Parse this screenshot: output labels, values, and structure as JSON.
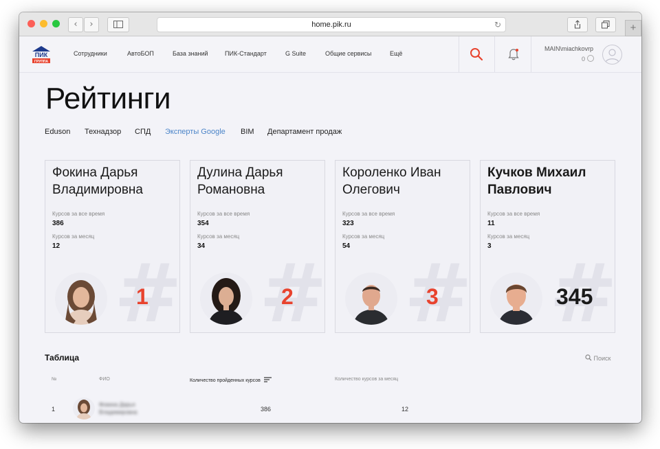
{
  "browser": {
    "url": "home.pik.ru"
  },
  "header": {
    "logo_text_top": "ПИК",
    "logo_text_bottom": "ГРУППА",
    "nav": [
      "Сотрудники",
      "АвтоБОП",
      "База знаний",
      "ПИК-Стандарт",
      "G Suite",
      "Общие сервисы",
      "Ещё"
    ],
    "user": "MAIN\\miachkovrp",
    "counter": "0",
    "accent": "#e8432e"
  },
  "page": {
    "title": "Рейтинги"
  },
  "tabs": [
    {
      "label": "Eduson",
      "active": false
    },
    {
      "label": "Технадзор",
      "active": false
    },
    {
      "label": "СПД",
      "active": false
    },
    {
      "label": "Эксперты Google",
      "active": true
    },
    {
      "label": "BIM",
      "active": false
    },
    {
      "label": "Департамент продаж",
      "active": false
    }
  ],
  "cards": [
    {
      "first": "Фокина Дарья",
      "second": "Владимировна",
      "label_all": "Курсов за все время",
      "all": "386",
      "label_month": "Курсов за месяц",
      "month": "12",
      "rank": "1"
    },
    {
      "first": "Дулина Дарья",
      "second": "Романовна",
      "label_all": "Курсов за все время",
      "all": "354",
      "label_month": "Курсов за месяц",
      "month": "34",
      "rank": "2"
    },
    {
      "first": "Короленко Иван",
      "second": "Олегович",
      "label_all": "Курсов за все время",
      "all": "323",
      "label_month": "Курсов за месяц",
      "month": "54",
      "rank": "3"
    },
    {
      "first": "Кучков Михаил",
      "second": "Павлович",
      "label_all": "Курсов за все время",
      "all": "11",
      "label_month": "Курсов за месяц",
      "month": "3",
      "rank": "345"
    }
  ],
  "table": {
    "title": "Таблица",
    "search_label": "Поиск",
    "columns": [
      "№",
      "ФИО",
      "Количество пройденных курсов",
      "Количество курсов за месяц"
    ],
    "rows": [
      {
        "index": "1",
        "name_first": "Фокина Дарья",
        "name_second": "Владимировна",
        "total": "386",
        "month": "12"
      }
    ]
  }
}
